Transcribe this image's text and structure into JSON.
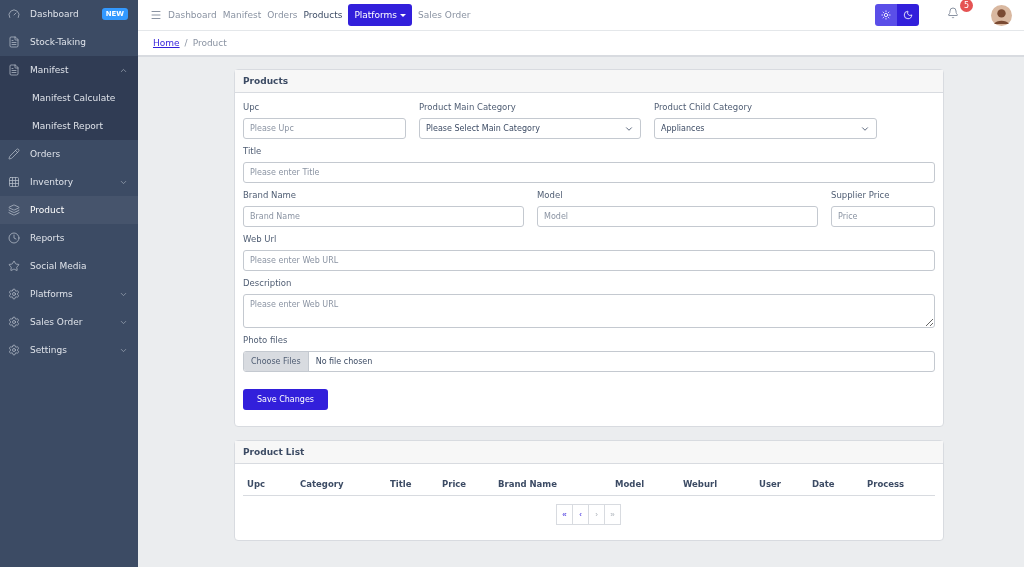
{
  "sidebar": {
    "items": [
      {
        "label": "Dashboard",
        "badge": "NEW",
        "selected": false,
        "expanded": false,
        "has_caret": false
      },
      {
        "label": "Stock-Taking",
        "selected": false,
        "expanded": false,
        "has_caret": false
      },
      {
        "label": "Manifest",
        "selected": false,
        "expanded": true,
        "has_caret": true,
        "children": [
          {
            "label": "Manifest Calculate"
          },
          {
            "label": "Manifest Report"
          }
        ]
      },
      {
        "label": "Orders",
        "selected": false,
        "expanded": false,
        "has_caret": false
      },
      {
        "label": "Inventory",
        "selected": false,
        "expanded": false,
        "has_caret": true
      },
      {
        "label": "Product",
        "selected": true,
        "expanded": false,
        "has_caret": false
      },
      {
        "label": "Reports",
        "selected": false,
        "expanded": false,
        "has_caret": false
      },
      {
        "label": "Social Media",
        "selected": false,
        "expanded": false,
        "has_caret": false
      },
      {
        "label": "Platforms",
        "selected": false,
        "expanded": false,
        "has_caret": true
      },
      {
        "label": "Sales Order",
        "selected": false,
        "expanded": false,
        "has_caret": true
      },
      {
        "label": "Settings",
        "selected": false,
        "expanded": false,
        "has_caret": true
      }
    ]
  },
  "topbar": {
    "links": [
      {
        "label": "Dashboard",
        "kind": "link",
        "selected": false
      },
      {
        "label": "Manifest",
        "kind": "link",
        "selected": false
      },
      {
        "label": "Orders",
        "kind": "link",
        "selected": false
      },
      {
        "label": "Products",
        "kind": "link",
        "selected": true
      },
      {
        "label": "Platforms",
        "kind": "dropdown",
        "selected": false
      },
      {
        "label": "Sales Order",
        "kind": "link",
        "selected": false
      }
    ],
    "theme_toggle": [
      {
        "selected": false
      },
      {
        "selected": true
      }
    ],
    "notifications": "5"
  },
  "breadcrumb": {
    "items": [
      {
        "label": "Home",
        "kind": "link"
      },
      {
        "label": "Product",
        "kind": "current"
      }
    ],
    "separator": "/"
  },
  "products_card": {
    "title": "Products",
    "rows": [
      [
        {
          "label": "Upc",
          "kind": "input",
          "placeholder": "Please Upc"
        },
        {
          "label": "Product Main Category",
          "kind": "select",
          "value": "Please Select Main Category"
        },
        {
          "label": "Product Child Category",
          "kind": "select",
          "value": "Appliances"
        }
      ],
      [
        {
          "label": "Title",
          "kind": "input",
          "placeholder": "Please enter Title"
        }
      ],
      [
        {
          "label": "Brand Name",
          "kind": "input",
          "placeholder": "Brand Name"
        },
        {
          "label": "Model",
          "kind": "input",
          "placeholder": "Model"
        },
        {
          "label": "Supplier Price",
          "kind": "input",
          "placeholder": "Price"
        }
      ],
      [
        {
          "label": "Web Url",
          "kind": "input",
          "placeholder": "Please enter Web URL"
        }
      ],
      [
        {
          "label": "Description",
          "kind": "textarea",
          "placeholder": "Please enter Web URL"
        }
      ],
      [
        {
          "label": "Photo files",
          "kind": "file",
          "button": "Choose Files",
          "value": "No file chosen"
        }
      ]
    ],
    "save_button": "Save Changes"
  },
  "product_list": {
    "title": "Product List",
    "columns": [
      "Upc",
      "Category",
      "Title",
      "Price",
      "Brand Name",
      "Model",
      "Weburl",
      "User",
      "Date",
      "Process"
    ],
    "pagination": [
      {
        "label": "«",
        "disabled": false
      },
      {
        "label": "‹",
        "disabled": false
      },
      {
        "label": "›",
        "disabled": true
      },
      {
        "label": "»",
        "disabled": true
      }
    ]
  }
}
